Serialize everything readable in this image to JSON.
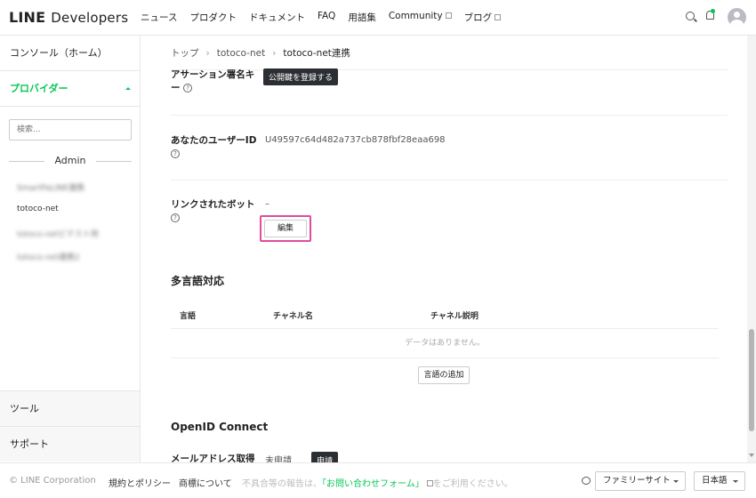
{
  "header": {
    "logo_main": "LINE",
    "logo_sub": "Developers",
    "nav": [
      "ニュース",
      "プロダクト",
      "ドキュメント",
      "FAQ",
      "用語集",
      "Community",
      "ブログ"
    ]
  },
  "sidebar": {
    "console": "コンソール（ホーム）",
    "providers": "プロバイダー",
    "search_placeholder": "検索...",
    "admin_label": "Admin",
    "channels": [
      "SmartPaLINE連携",
      "totoco-net",
      "totoco-netビテスト用",
      "totoco-net連携2"
    ],
    "tools": "ツール",
    "support": "サポート"
  },
  "breadcrumb": [
    "トップ",
    "totoco-net",
    "totoco-net連携"
  ],
  "settings": {
    "assertion_label_1": "アサーション署名キ",
    "assertion_label_2": "ー",
    "assertion_button": "公開鍵を登録する",
    "userid_label": "あなたのユーザーID",
    "userid_value": "U49597c64d482a737cb878fbf28eaa698",
    "bot_label": "リンクされたボット",
    "bot_value": "–",
    "edit_button": "編集"
  },
  "i18n": {
    "title": "多言語対応",
    "col_lang": "言語",
    "col_name": "チャネル名",
    "col_desc": "チャネル説明",
    "empty": "データはありません。",
    "add_button": "言語の追加"
  },
  "openid": {
    "title": "OpenID Connect",
    "email_label": "メールアドレス取得",
    "email_status": "未申請",
    "apply_button": "申請"
  },
  "footer": {
    "copyright": "© LINE Corporation",
    "terms": "規約とポリシー",
    "trademark": "商標について",
    "report_prefix": "不具合等の報告は、",
    "report_link": "「お問い合わせフォーム」",
    "report_suffix": "をご利用ください。",
    "family": "ファミリーサイト",
    "language": "日本語"
  },
  "colors": {
    "green": "#06c755",
    "highlight": "#e04d9a"
  }
}
